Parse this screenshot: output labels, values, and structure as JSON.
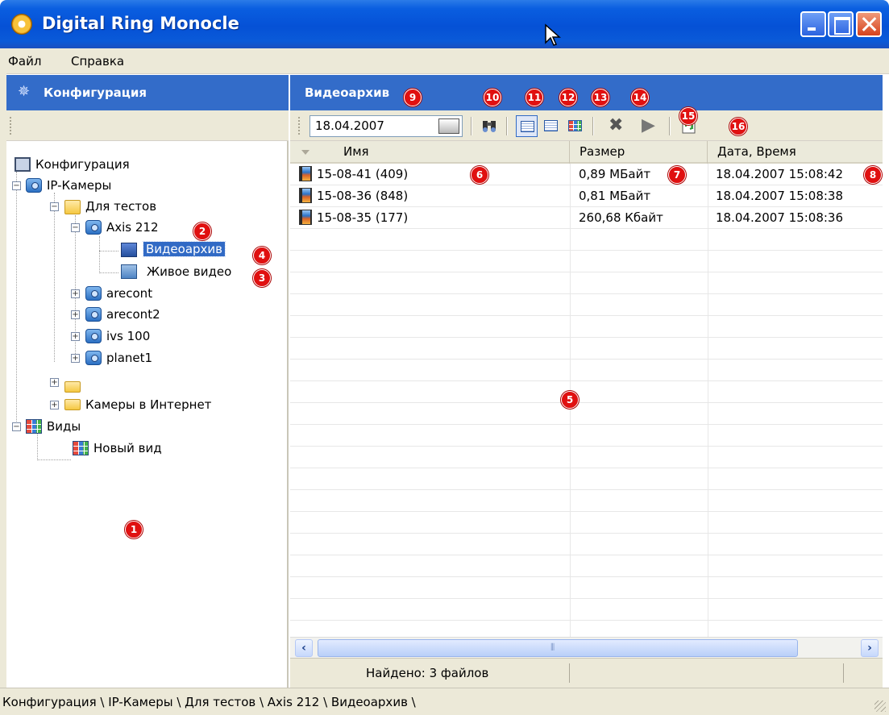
{
  "window": {
    "title": "Digital Ring Monocle"
  },
  "menu": {
    "items": [
      "Файл",
      "Справка"
    ]
  },
  "left_panel": {
    "header": "Конфигурация",
    "tree": {
      "root": "Конфигурация",
      "ip_cameras": "IP-Камеры",
      "for_tests": "Для тестов",
      "axis212": "Axis 212",
      "video_archive": "Видеоархив",
      "live_video": "Живое видео",
      "arecont": "arecont",
      "arecont2": "arecont2",
      "ivs100": "ivs 100",
      "planet1": "planet1",
      "empty_folder": "",
      "internet_cameras": "Камеры в Интернет",
      "views": "Виды",
      "new_view": "Новый вид"
    }
  },
  "right_panel": {
    "header": "Видеоархив",
    "toolbar": {
      "date": "18.04.2007",
      "icons": [
        "binoculars-icon",
        "list-view-icon",
        "details-view-icon",
        "thumbnail-view-icon",
        "delete-icon",
        "play-icon",
        "refresh-icon"
      ]
    },
    "table": {
      "columns": [
        "Имя",
        "Размер",
        "Дата, Время"
      ],
      "rows": [
        {
          "name": "15-08-41 (409)",
          "size": "0,89 МБайт",
          "datetime": "18.04.2007 15:08:42"
        },
        {
          "name": "15-08-36 (848)",
          "size": "0,81 МБайт",
          "datetime": "18.04.2007 15:08:38"
        },
        {
          "name": "15-08-35 (177)",
          "size": "260,68 Кбайт",
          "datetime": "18.04.2007 15:08:36"
        }
      ]
    },
    "status": "Найдено: 3 файлов"
  },
  "statusbar": {
    "path": "Конфигурация \\ IP-Камеры \\ Для тестов \\ Axis 212 \\ Видеоархив \\"
  },
  "callouts": {
    "c1": "1",
    "c2": "2",
    "c3": "3",
    "c4": "4",
    "c5": "5",
    "c6": "6",
    "c7": "7",
    "c8": "8",
    "c9": "9",
    "c10": "10",
    "c11": "11",
    "c12": "12",
    "c13": "13",
    "c14": "14",
    "c15": "15",
    "c16": "16"
  },
  "colors": {
    "titlebar": "#0551d6",
    "panel_header": "#336cc9",
    "selection": "#316ac5",
    "callout": "#e01010",
    "chrome": "#ece9d8"
  }
}
